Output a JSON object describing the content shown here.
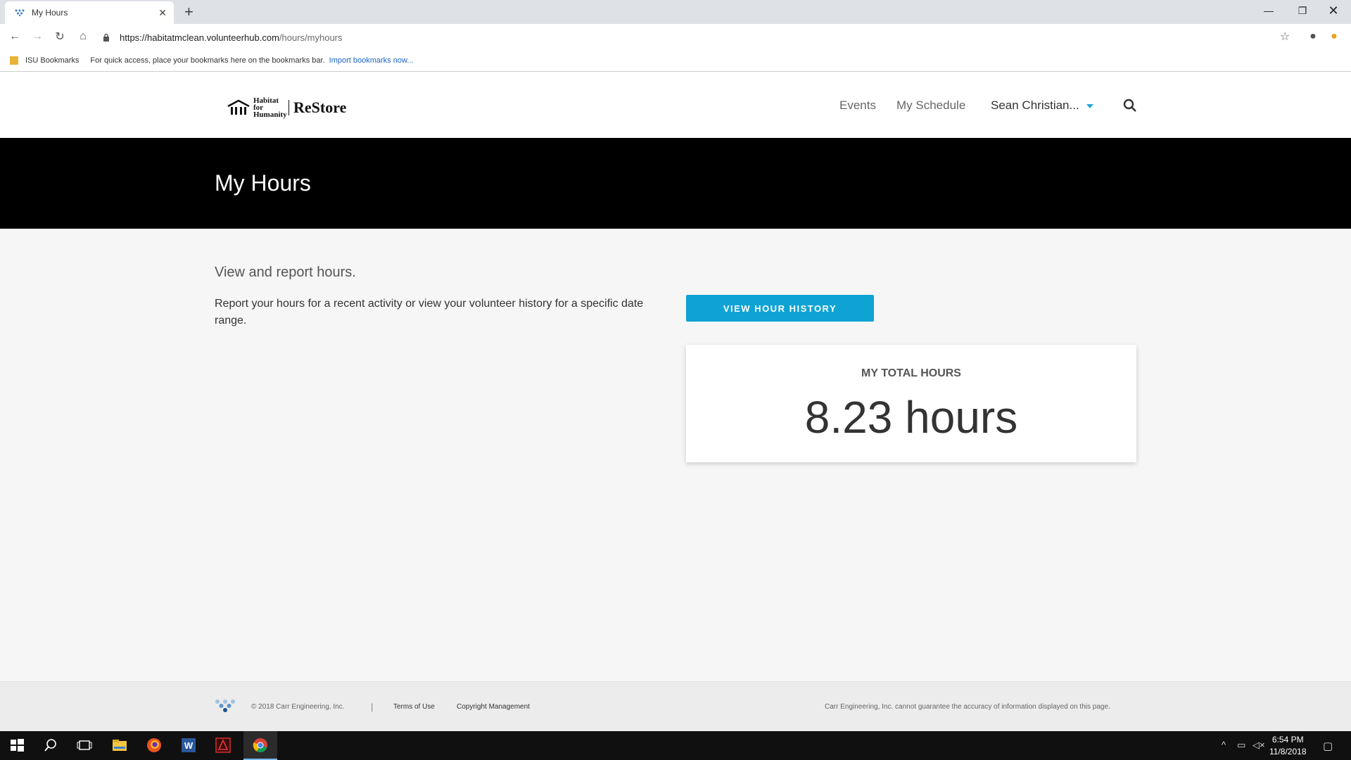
{
  "browser": {
    "tab_title": "My Hours",
    "url_host": "https://habitatmclean.volunteerhub.com",
    "url_path": "/hours/myhours",
    "bookmarks_folder": "ISU Bookmarks",
    "bookmarks_hint": "For quick access, place your bookmarks here on the bookmarks bar.",
    "bookmarks_link": "Import bookmarks now..."
  },
  "header": {
    "logo_habitat": "Habitat for Humanity",
    "logo_restore": "ReStore",
    "nav_events": "Events",
    "nav_schedule": "My Schedule",
    "nav_user": "Sean Christian..."
  },
  "banner": {
    "title": "My Hours"
  },
  "main": {
    "intro": "View and report hours.",
    "description": "Report your hours for a recent activity or view your volunteer history for a specific date range.",
    "history_button": "VIEW HOUR HISTORY",
    "total_label": "MY TOTAL HOURS",
    "total_value": "8.23 hours"
  },
  "footer": {
    "copyright": "© 2018 Carr Engineering, Inc.",
    "separator": "|",
    "terms": "Terms of Use",
    "copyright_mgmt": "Copyright Management",
    "disclaimer": "Carr Engineering, Inc. cannot guarantee the accuracy of information displayed on this page."
  },
  "taskbar": {
    "time": "6:54 PM",
    "date": "11/8/2018"
  },
  "colors": {
    "accent": "#0fa3d4",
    "banner": "#000000"
  }
}
